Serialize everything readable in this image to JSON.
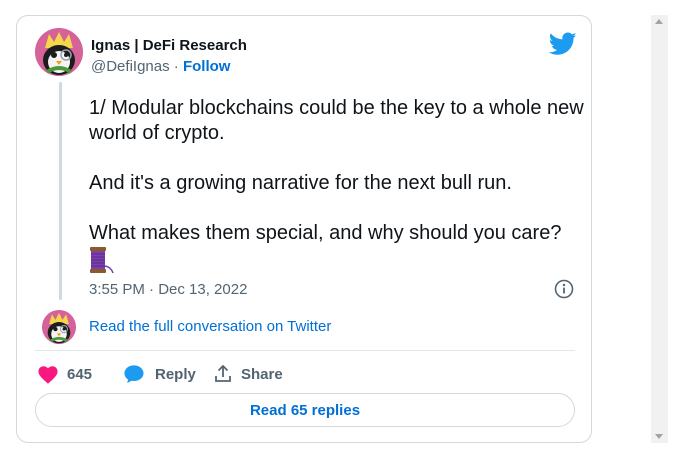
{
  "author": {
    "name": "Ignas | DeFi Research",
    "handle": "@DefiIgnas",
    "separator": " · ",
    "follow_label": "Follow"
  },
  "tweet": {
    "text": "1/ Modular blockchains could be the key to a whole new world of crypto.\n\nAnd it's a growing narrative for the next bull run.\n\nWhat makes them special, and why should you care?",
    "emoji": "spool-of-thread-icon",
    "timestamp": "3:55 PM · Dec 13, 2022"
  },
  "conversation_link": "Read the full conversation on Twitter",
  "actions": {
    "likes_count": "645",
    "reply_label": "Reply",
    "share_label": "Share"
  },
  "read_replies_label": "Read 65 replies",
  "colors": {
    "link": "#006fd6",
    "like": "#f91880",
    "twitter_blue": "#1d9bf0",
    "muted": "#536471",
    "border": "#cfd9de"
  }
}
